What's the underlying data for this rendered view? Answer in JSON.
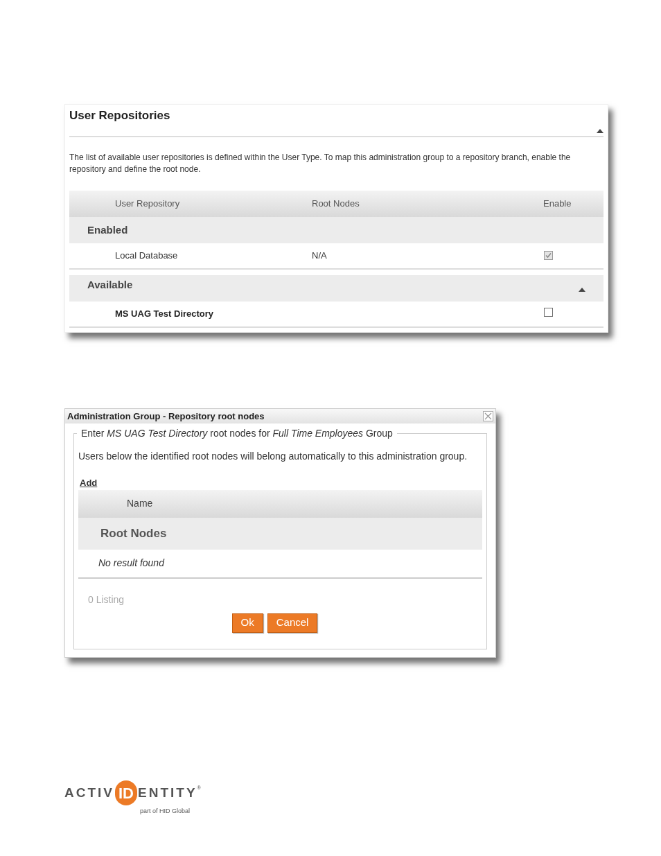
{
  "repositories": {
    "title": "User Repositories",
    "panel_expanded": true,
    "description": "The list of available user repositories is defined within the User Type. To map this administration group to a repository branch, enable the repository and define the root node.",
    "columns": [
      "User Repository",
      "Root Nodes",
      "Enable"
    ],
    "groups": [
      {
        "label": "Enabled",
        "rows": [
          {
            "name": "Local Database",
            "root_nodes": "N/A",
            "checked": true,
            "disabled": true,
            "emphasized": false
          }
        ]
      },
      {
        "label": "Available",
        "expanded": true,
        "rows": [
          {
            "name": "MS UAG Test Directory",
            "checked": false,
            "disabled": false,
            "emphasized": true
          }
        ]
      }
    ]
  },
  "dialog": {
    "title": "Administration Group - Repository root nodes",
    "legend": "Enter *MS UAG Test Directory* root nodes for *Full Time Employees* Group",
    "info": "Users below the identified root nodes will belong automatically to this administration group.",
    "add_link": "Add",
    "columns": [
      "Name"
    ],
    "group_label": "Root Nodes",
    "empty_text": "No result found",
    "listing": "0 Listing",
    "buttons": [
      "Ok",
      "Cancel"
    ]
  },
  "logo": {
    "left": "ACTIV",
    "mark": "ID",
    "right": "ENTITY",
    "registered": "®",
    "tagline": "part of HID Global"
  }
}
